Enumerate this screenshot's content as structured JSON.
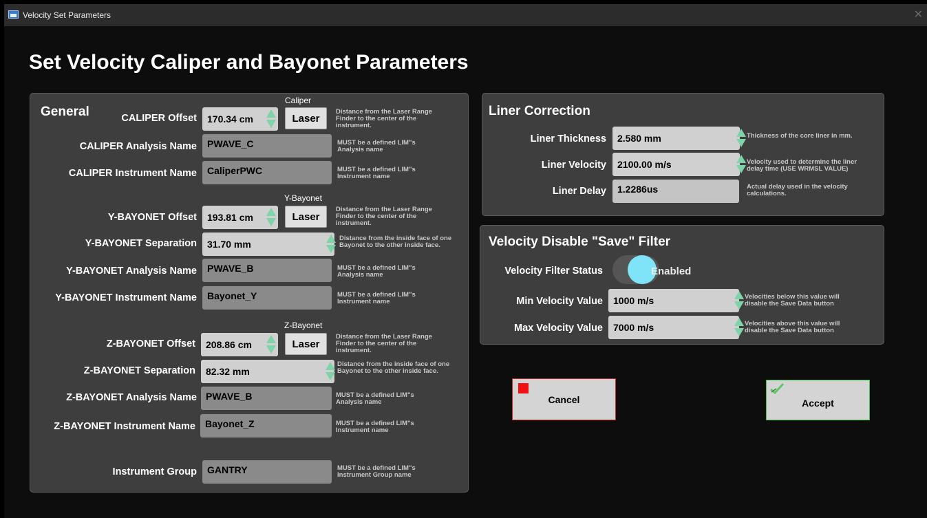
{
  "window": {
    "title": "Velocity Set Parameters"
  },
  "heading": "Set Velocity Caliper and Bayonet Parameters",
  "general": {
    "title": "General",
    "caliper_head": "Caliper",
    "caliper_offset_label": "CALIPER Offset",
    "caliper_offset_value": "170.34 cm",
    "caliper_laser": "Laser",
    "caliper_offset_note": "Distance from the Laser Range\nFinder  to the center of the\ninstrument.",
    "caliper_analysis_label": "CALIPER Analysis Name",
    "caliper_analysis_value": "PWAVE_C",
    "caliper_analysis_note": "MUST be a defined LIM\"s\nAnalysis name",
    "caliper_instrument_label": "CALIPER Instrument Name",
    "caliper_instrument_value": "CaliperPWC",
    "caliper_instrument_note": "MUST be a defined LIM\"s\nInstrument name",
    "ybay_head": "Y-Bayonet",
    "ybay_offset_label": "Y-BAYONET Offset",
    "ybay_offset_value": "193.81 cm",
    "ybay_laser": "Laser",
    "ybay_offset_note": "Distance from the Laser Range\nFinder  to the center of the\ninstrument.",
    "ybay_sep_label": "Y-BAYONET Separation",
    "ybay_sep_value": "31.70 mm",
    "ybay_sep_note": "Distance from the inside face of one\nBayonet to the other inside face.",
    "ybay_analysis_label": "Y-BAYONET Analysis Name",
    "ybay_analysis_value": "PWAVE_B",
    "ybay_analysis_note": "MUST be a defined LIM\"s\nAnalysis name",
    "ybay_instrument_label": "Y-BAYONET Instrument Name",
    "ybay_instrument_value": "Bayonet_Y",
    "ybay_instrument_note": "MUST be a defined LIM\"s\nInstrument name",
    "zbay_head": "Z-Bayonet",
    "zbay_offset_label": "Z-BAYONET Offset",
    "zbay_offset_value": "208.86 cm",
    "zbay_laser": "Laser",
    "zbay_offset_note": "Distance from the Laser Range\nFinder  to the center of the\ninstrument.",
    "zbay_sep_label": "Z-BAYONET Separation",
    "zbay_sep_value": "82.32 mm",
    "zbay_sep_note": "Distance from the inside face of one\nBayonet to the other inside face.",
    "zbay_analysis_label": "Z-BAYONET Analysis Name",
    "zbay_analysis_value": "PWAVE_B",
    "zbay_analysis_note": "MUST be a defined LIM\"s\nAnalysis name",
    "zbay_instrument_label": "Z-BAYONET Instrument Name",
    "zbay_instrument_value": "Bayonet_Z",
    "zbay_instrument_note": "MUST be a defined LIM\"s\nInstrument name",
    "group_label": "Instrument Group",
    "group_value": "GANTRY",
    "group_note": "MUST be a defined LIM\"s\nInstrument Group name"
  },
  "liner": {
    "title": "Liner Correction",
    "thickness_label": "Liner Thickness",
    "thickness_value": "2.580 mm",
    "thickness_note": "Thickness of the core liner in mm.",
    "velocity_label": "Liner Velocity",
    "velocity_value": "2100.00 m/s",
    "velocity_note": "Velocity used to determine the liner\ndelay time (USE WRMSL VALUE)",
    "delay_label": "Liner Delay",
    "delay_value": "1.2286us",
    "delay_note": "Actual delay used in the velocity\ncalculations."
  },
  "filter": {
    "title": "Velocity Disable \"Save\" Filter",
    "status_label": "Velocity Filter Status",
    "status_value": "Enabled",
    "min_label": "Min Velocity Value",
    "min_value": "1000 m/s",
    "min_note": "Velocities below this value will\ndisable the Save Data button",
    "max_label": "Max Velocity Value",
    "max_value": "7000 m/s",
    "max_note": "Velocities above this value will\ndisable the Save Data button"
  },
  "actions": {
    "cancel": "Cancel",
    "accept": "Accept"
  },
  "colors": {
    "panel": "#3e3e3e",
    "spinner": "#7ed3a8",
    "toggle_on": "#7fe4f7",
    "cancel_border": "#c92a2a",
    "accept_border": "#44c24f"
  }
}
